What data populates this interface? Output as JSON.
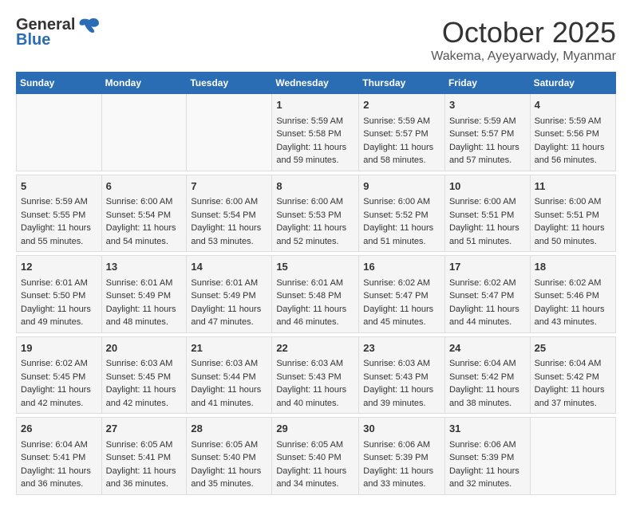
{
  "header": {
    "logo_general": "General",
    "logo_blue": "Blue",
    "month_title": "October 2025",
    "location": "Wakema, Ayeyarwady, Myanmar"
  },
  "weekdays": [
    "Sunday",
    "Monday",
    "Tuesday",
    "Wednesday",
    "Thursday",
    "Friday",
    "Saturday"
  ],
  "weeks": [
    [
      {
        "day": "",
        "info": ""
      },
      {
        "day": "",
        "info": ""
      },
      {
        "day": "",
        "info": ""
      },
      {
        "day": "1",
        "sunrise": "5:59 AM",
        "sunset": "5:58 PM",
        "daylight": "11 hours and 59 minutes."
      },
      {
        "day": "2",
        "sunrise": "5:59 AM",
        "sunset": "5:57 PM",
        "daylight": "11 hours and 58 minutes."
      },
      {
        "day": "3",
        "sunrise": "5:59 AM",
        "sunset": "5:57 PM",
        "daylight": "11 hours and 57 minutes."
      },
      {
        "day": "4",
        "sunrise": "5:59 AM",
        "sunset": "5:56 PM",
        "daylight": "11 hours and 56 minutes."
      }
    ],
    [
      {
        "day": "5",
        "sunrise": "5:59 AM",
        "sunset": "5:55 PM",
        "daylight": "11 hours and 55 minutes."
      },
      {
        "day": "6",
        "sunrise": "6:00 AM",
        "sunset": "5:54 PM",
        "daylight": "11 hours and 54 minutes."
      },
      {
        "day": "7",
        "sunrise": "6:00 AM",
        "sunset": "5:54 PM",
        "daylight": "11 hours and 53 minutes."
      },
      {
        "day": "8",
        "sunrise": "6:00 AM",
        "sunset": "5:53 PM",
        "daylight": "11 hours and 52 minutes."
      },
      {
        "day": "9",
        "sunrise": "6:00 AM",
        "sunset": "5:52 PM",
        "daylight": "11 hours and 51 minutes."
      },
      {
        "day": "10",
        "sunrise": "6:00 AM",
        "sunset": "5:51 PM",
        "daylight": "11 hours and 51 minutes."
      },
      {
        "day": "11",
        "sunrise": "6:00 AM",
        "sunset": "5:51 PM",
        "daylight": "11 hours and 50 minutes."
      }
    ],
    [
      {
        "day": "12",
        "sunrise": "6:01 AM",
        "sunset": "5:50 PM",
        "daylight": "11 hours and 49 minutes."
      },
      {
        "day": "13",
        "sunrise": "6:01 AM",
        "sunset": "5:49 PM",
        "daylight": "11 hours and 48 minutes."
      },
      {
        "day": "14",
        "sunrise": "6:01 AM",
        "sunset": "5:49 PM",
        "daylight": "11 hours and 47 minutes."
      },
      {
        "day": "15",
        "sunrise": "6:01 AM",
        "sunset": "5:48 PM",
        "daylight": "11 hours and 46 minutes."
      },
      {
        "day": "16",
        "sunrise": "6:02 AM",
        "sunset": "5:47 PM",
        "daylight": "11 hours and 45 minutes."
      },
      {
        "day": "17",
        "sunrise": "6:02 AM",
        "sunset": "5:47 PM",
        "daylight": "11 hours and 44 minutes."
      },
      {
        "day": "18",
        "sunrise": "6:02 AM",
        "sunset": "5:46 PM",
        "daylight": "11 hours and 43 minutes."
      }
    ],
    [
      {
        "day": "19",
        "sunrise": "6:02 AM",
        "sunset": "5:45 PM",
        "daylight": "11 hours and 42 minutes."
      },
      {
        "day": "20",
        "sunrise": "6:03 AM",
        "sunset": "5:45 PM",
        "daylight": "11 hours and 42 minutes."
      },
      {
        "day": "21",
        "sunrise": "6:03 AM",
        "sunset": "5:44 PM",
        "daylight": "11 hours and 41 minutes."
      },
      {
        "day": "22",
        "sunrise": "6:03 AM",
        "sunset": "5:43 PM",
        "daylight": "11 hours and 40 minutes."
      },
      {
        "day": "23",
        "sunrise": "6:03 AM",
        "sunset": "5:43 PM",
        "daylight": "11 hours and 39 minutes."
      },
      {
        "day": "24",
        "sunrise": "6:04 AM",
        "sunset": "5:42 PM",
        "daylight": "11 hours and 38 minutes."
      },
      {
        "day": "25",
        "sunrise": "6:04 AM",
        "sunset": "5:42 PM",
        "daylight": "11 hours and 37 minutes."
      }
    ],
    [
      {
        "day": "26",
        "sunrise": "6:04 AM",
        "sunset": "5:41 PM",
        "daylight": "11 hours and 36 minutes."
      },
      {
        "day": "27",
        "sunrise": "6:05 AM",
        "sunset": "5:41 PM",
        "daylight": "11 hours and 36 minutes."
      },
      {
        "day": "28",
        "sunrise": "6:05 AM",
        "sunset": "5:40 PM",
        "daylight": "11 hours and 35 minutes."
      },
      {
        "day": "29",
        "sunrise": "6:05 AM",
        "sunset": "5:40 PM",
        "daylight": "11 hours and 34 minutes."
      },
      {
        "day": "30",
        "sunrise": "6:06 AM",
        "sunset": "5:39 PM",
        "daylight": "11 hours and 33 minutes."
      },
      {
        "day": "31",
        "sunrise": "6:06 AM",
        "sunset": "5:39 PM",
        "daylight": "11 hours and 32 minutes."
      },
      {
        "day": "",
        "info": ""
      }
    ]
  ],
  "labels": {
    "sunrise": "Sunrise:",
    "sunset": "Sunset:",
    "daylight": "Daylight:"
  }
}
